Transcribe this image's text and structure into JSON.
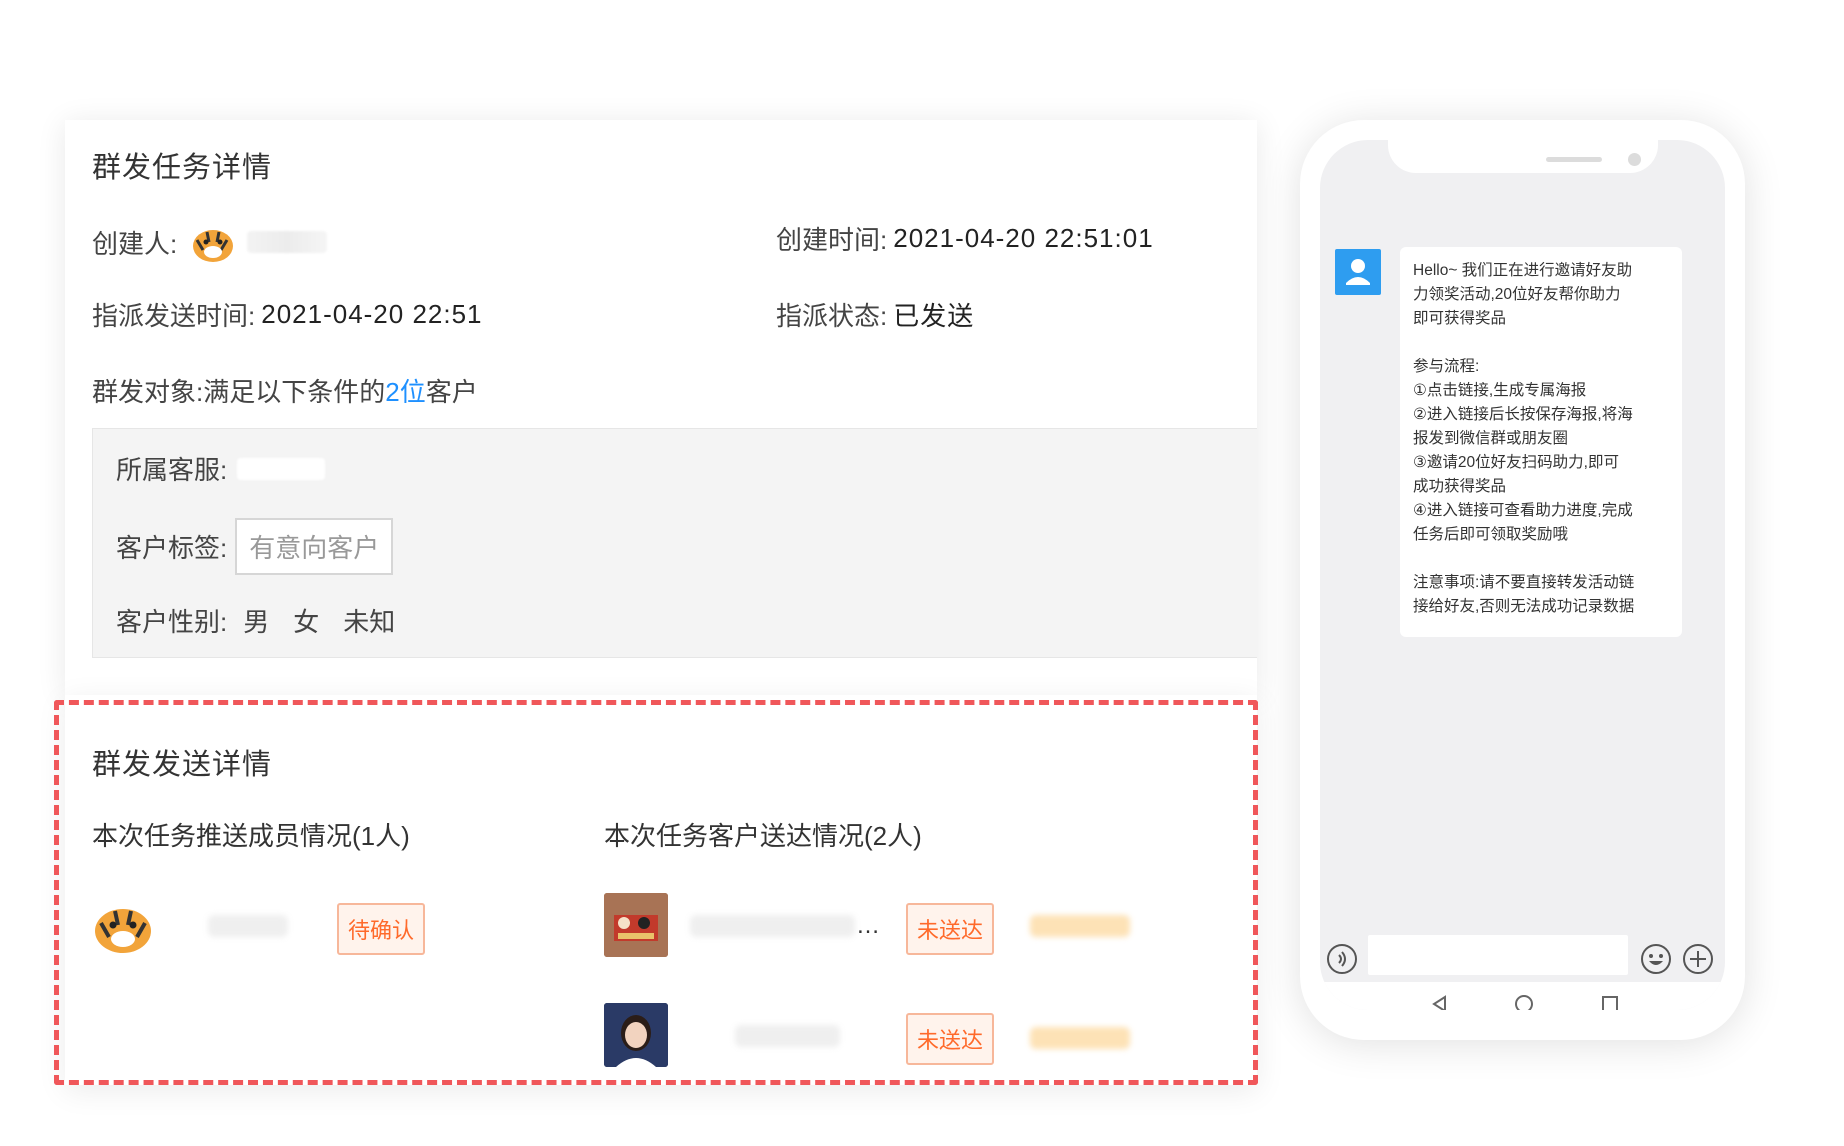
{
  "task_panel": {
    "title": "群发任务详情",
    "creator_label": "创建人:",
    "create_time_label": "创建时间:",
    "create_time_value": "2021-04-20 22:51:01",
    "assign_time_label": "指派发送时间:",
    "assign_time_value": "2021-04-20 22:51",
    "assign_status_label": "指派状态:",
    "assign_status_value": "已发送",
    "target_prefix": "群发对象:满足以下条件的",
    "target_count": "2位",
    "target_suffix": "客户",
    "conditions": {
      "service_label": "所属客服:",
      "tag_label": "客户标签:",
      "tag_value": "有意向客户",
      "gender_label": "客户性别:",
      "genders": [
        "男",
        "女",
        "未知"
      ]
    }
  },
  "send_panel": {
    "title": "群发发送详情",
    "members_heading": "本次任务推送成员情况(1人)",
    "customers_heading": "本次任务客户送达情况(2人)",
    "member_status": "待确认",
    "customer_ellipsis": "…",
    "customer_status_1": "未送达",
    "customer_status_2": "未送达"
  },
  "phone": {
    "message_lines": "Hello~ 我们正在进行邀请好友助\n力领奖活动,20位好友帮你助力\n即可获得奖品\n\n参与流程:\n①点击链接,生成专属海报\n②进入链接后长按保存海报,将海\n报发到微信群或朋友圈\n③邀请20位好友扫码助力,即可\n成功获得奖品\n④进入链接可查看助力进度,完成\n任务后即可领取奖励哦\n\n注意事项:请不要直接转发活动链\n接给好友,否则无法成功记录数据",
    "icons": [
      "voice-icon",
      "emoji-icon",
      "plus-icon",
      "back-icon",
      "home-icon",
      "recent-apps-icon"
    ]
  },
  "colors": {
    "accent_blue": "#1e90ff",
    "dashed_red": "#f0575a",
    "status_orange": "#ff6a2b"
  }
}
